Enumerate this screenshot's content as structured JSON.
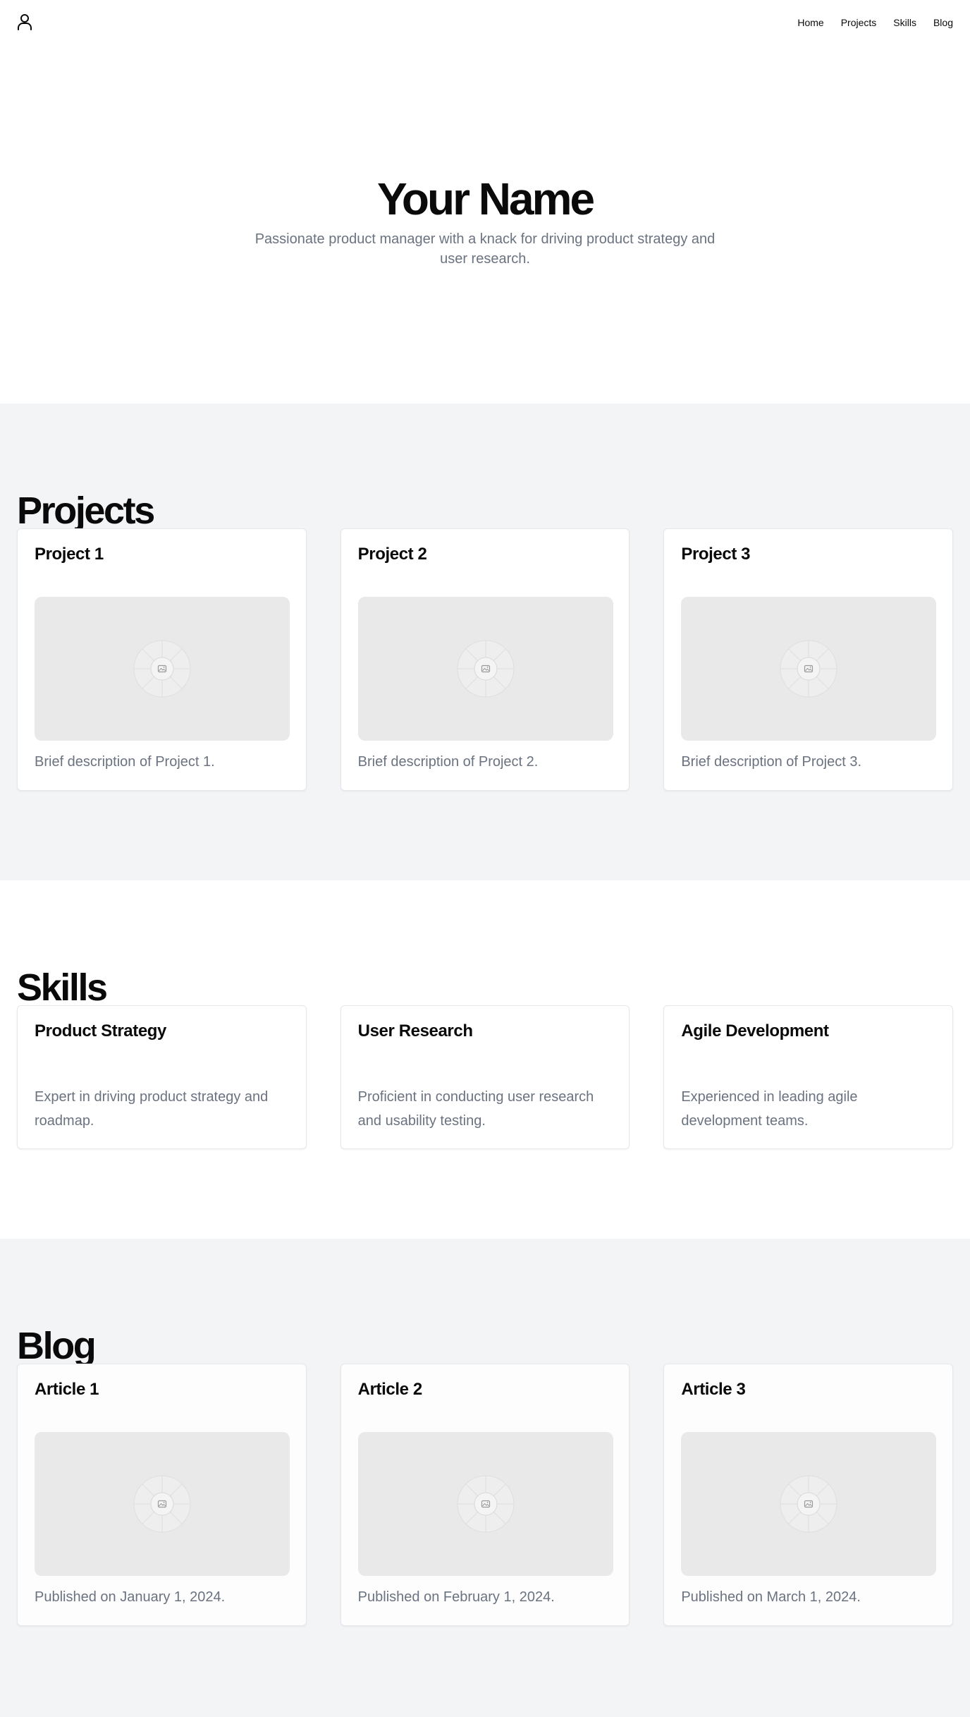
{
  "nav": {
    "logo_icon": "user-icon",
    "links": [
      "Home",
      "Projects",
      "Skills",
      "Blog"
    ]
  },
  "hero": {
    "title": "Your Name",
    "subtitle": "Passionate product manager with a knack for driving product strategy and user research."
  },
  "projects": {
    "title": "Projects",
    "items": [
      {
        "title": "Project 1",
        "image_icon": "image-placeholder-icon",
        "description": "Brief description of Project 1."
      },
      {
        "title": "Project 2",
        "image_icon": "image-placeholder-icon",
        "description": "Brief description of Project 2."
      },
      {
        "title": "Project 3",
        "image_icon": "image-placeholder-icon",
        "description": "Brief description of Project 3."
      }
    ]
  },
  "skills": {
    "title": "Skills",
    "items": [
      {
        "title": "Product Strategy",
        "description": "Expert in driving product strategy and roadmap."
      },
      {
        "title": "User Research",
        "description": "Proficient in conducting user research and usability testing."
      },
      {
        "title": "Agile Development",
        "description": "Experienced in leading agile development teams."
      }
    ]
  },
  "blog": {
    "title": "Blog",
    "items": [
      {
        "title": "Article 1",
        "image_icon": "image-placeholder-icon",
        "description": "Published on January 1, 2024."
      },
      {
        "title": "Article 2",
        "image_icon": "image-placeholder-icon",
        "description": "Published on February 1, 2024."
      },
      {
        "title": "Article 3",
        "image_icon": "image-placeholder-icon",
        "description": "Published on March 1, 2024."
      }
    ]
  },
  "colors": {
    "text": "#0a0a0a",
    "muted": "#6b7280",
    "section_bg": "#f3f4f6",
    "card_border": "#e5e7eb",
    "placeholder_bg": "#e9e9e9"
  }
}
